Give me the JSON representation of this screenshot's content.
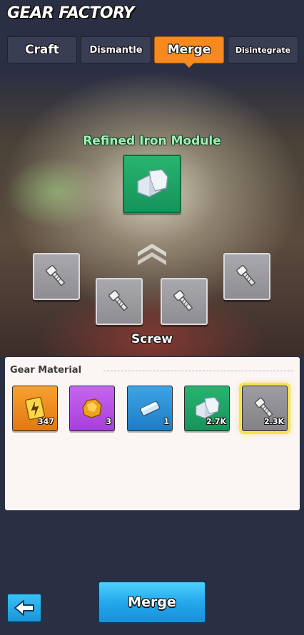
{
  "header": {
    "title": "GEAR FACTORY"
  },
  "tabs": [
    {
      "label": "Craft",
      "active": false
    },
    {
      "label": "Dismantle",
      "active": false
    },
    {
      "label": "Merge",
      "active": true
    },
    {
      "label": "Disintegrate",
      "active": false
    }
  ],
  "merge": {
    "product_name": "Refined Iron Module",
    "product_icon": "iron-module-icon",
    "ingredient_name": "Screw",
    "ingredient_icon": "screw-icon",
    "ingredient_slots": 4
  },
  "materials_panel": {
    "title": "Gear Material",
    "items": [
      {
        "icon": "lightning-manual-icon",
        "color": "#f08a1d",
        "count": "347"
      },
      {
        "icon": "gold-ore-icon",
        "color": "#b64be6",
        "count": "3"
      },
      {
        "icon": "blue-ingot-icon",
        "color": "#2e8ed6",
        "count": "1"
      },
      {
        "icon": "iron-module-icon",
        "color": "#1ea564",
        "count": "2.7K"
      },
      {
        "icon": "screw-icon",
        "color": "#8f8f95",
        "count": "2.3K",
        "selected": true
      }
    ]
  },
  "footer": {
    "back_icon": "back-arrow-icon",
    "merge_label": "Merge"
  },
  "colors": {
    "accent": "#f68a1e",
    "button_blue": "#24a8ec",
    "product_name": "#9df0b4"
  }
}
